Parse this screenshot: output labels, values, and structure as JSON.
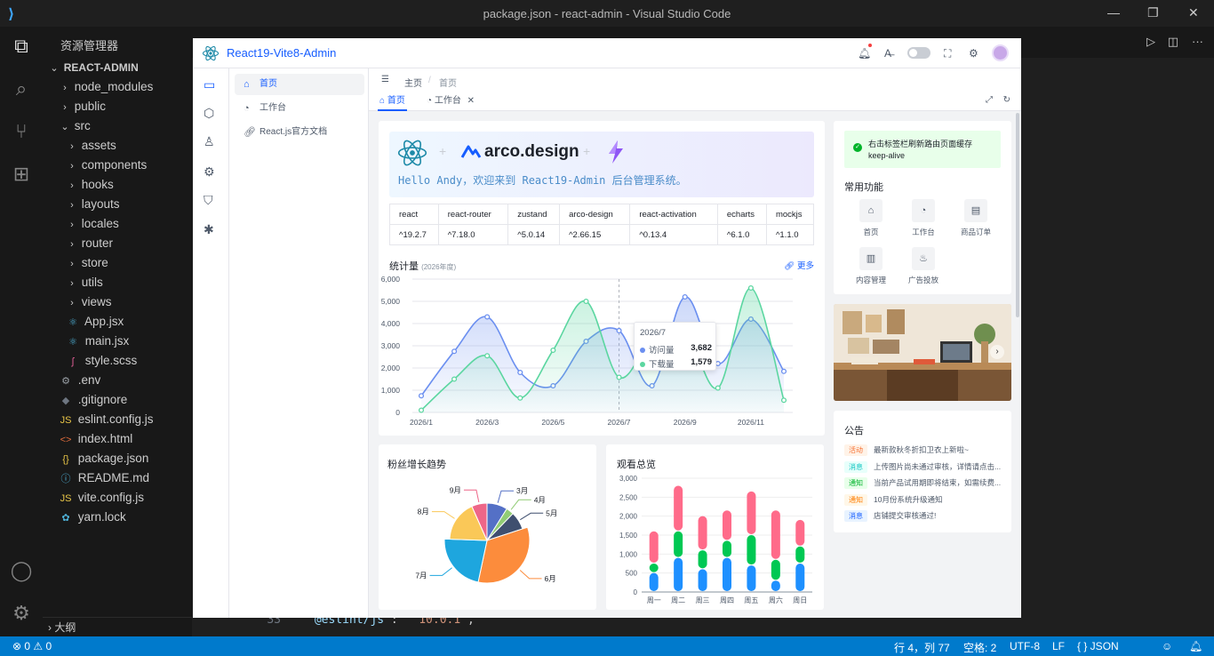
{
  "vscode": {
    "title": "package.json - react-admin - Visual Studio Code",
    "explorer_title": "资源管理器",
    "outline": "大纲",
    "tree": [
      {
        "label": "REACT-ADMIN",
        "kind": "root",
        "depth": 0
      },
      {
        "label": "node_modules",
        "kind": "folder",
        "depth": 1
      },
      {
        "label": "public",
        "kind": "folder",
        "depth": 1
      },
      {
        "label": "src",
        "kind": "open",
        "depth": 1
      },
      {
        "label": "assets",
        "kind": "folder",
        "depth": 2
      },
      {
        "label": "components",
        "kind": "folder",
        "depth": 2
      },
      {
        "label": "hooks",
        "kind": "folder",
        "depth": 2
      },
      {
        "label": "layouts",
        "kind": "folder",
        "depth": 2
      },
      {
        "label": "locales",
        "kind": "folder",
        "depth": 2
      },
      {
        "label": "router",
        "kind": "folder",
        "depth": 2
      },
      {
        "label": "store",
        "kind": "folder",
        "depth": 2
      },
      {
        "label": "utils",
        "kind": "folder",
        "depth": 2
      },
      {
        "label": "views",
        "kind": "folder",
        "depth": 2
      },
      {
        "label": "App.jsx",
        "kind": "react",
        "depth": 2
      },
      {
        "label": "main.jsx",
        "kind": "react",
        "depth": 2
      },
      {
        "label": "style.scss",
        "kind": "sass",
        "depth": 2
      },
      {
        "label": ".env",
        "kind": "gear",
        "depth": 1
      },
      {
        "label": ".gitignore",
        "kind": "git",
        "depth": 1
      },
      {
        "label": "eslint.config.js",
        "kind": "js",
        "depth": 1
      },
      {
        "label": "index.html",
        "kind": "html",
        "depth": 1
      },
      {
        "label": "package.json",
        "kind": "json",
        "depth": 1
      },
      {
        "label": "README.md",
        "kind": "info",
        "depth": 1
      },
      {
        "label": "vite.config.js",
        "kind": "js",
        "depth": 1
      },
      {
        "label": "yarn.lock",
        "kind": "yarn",
        "depth": 1
      }
    ],
    "code": {
      "line_no": "33",
      "key": "\"@eslint/js\"",
      "value": "\"^10.0.1\""
    },
    "status": {
      "errors": "⊗ 0 ⚠ 0",
      "position": "行 4，列 77",
      "spaces": "空格: 2",
      "encoding": "UTF-8",
      "eol": "LF",
      "lang": "{ } JSON"
    }
  },
  "app": {
    "name": "React19-Vite8-Admin",
    "menu": [
      "首页",
      "工作台",
      "React.js官方文档"
    ],
    "breadcrumb": [
      "主页",
      "首页"
    ],
    "tabs": [
      "首页",
      "工作台"
    ],
    "banner": {
      "brand": "arco.design",
      "greeting": "Hello Andy，欢迎来到 React19-Admin 后台管理系统。"
    },
    "versions": {
      "headers": [
        "react",
        "react-router",
        "zustand",
        "arco-design",
        "react-activation",
        "echarts",
        "mockjs"
      ],
      "values": [
        "^19.2.7",
        "^7.18.0",
        "^5.0.14",
        "^2.66.15",
        "^0.13.4",
        "^6.1.0",
        "^1.1.0"
      ]
    },
    "stats_title": "统计量",
    "stats_sub": "(2026年度)",
    "more": "更多",
    "tooltip": {
      "title": "2026/7",
      "rows": [
        {
          "label": "访问量",
          "value": "3,682"
        },
        {
          "label": "下载量",
          "value": "1,579"
        }
      ]
    },
    "alert": {
      "line1": "右击标签栏刷新路由页面缓存",
      "line2": "keep-alive"
    },
    "common_title": "常用功能",
    "functions": [
      "首页",
      "工作台",
      "商品订单",
      "内容管理",
      "广告投放"
    ],
    "notice_title": "公告",
    "notices": [
      {
        "tag": "活动",
        "text": "最新款秋冬折扣卫衣上新啦~",
        "color": "#f77234",
        "bg": "#fff3e8"
      },
      {
        "tag": "消息",
        "text": "上传图片尚未通过审核，详情请点击...",
        "color": "#0fc6c2",
        "bg": "#e8fffb"
      },
      {
        "tag": "通知",
        "text": "当前产品试用期即将结束，如需续费...",
        "color": "#00b42a",
        "bg": "#e8ffea"
      },
      {
        "tag": "通知",
        "text": "10月份系统升级通知",
        "color": "#ff7d00",
        "bg": "#fff7e8"
      },
      {
        "tag": "消息",
        "text": "店铺提交审核通过!",
        "color": "#165dff",
        "bg": "#e8f3ff"
      }
    ],
    "fans_title": "粉丝增长趋势",
    "views_title": "观看总览"
  },
  "chart_data": [
    {
      "type": "area",
      "title": "统计量",
      "x": [
        "2026/1",
        "2026/2",
        "2026/3",
        "2026/4",
        "2026/5",
        "2026/6",
        "2026/7",
        "2026/8",
        "2026/9",
        "2026/10",
        "2026/11",
        "2026/12"
      ],
      "xticks": [
        "2026/1",
        "2026/3",
        "2026/5",
        "2026/7",
        "2026/9",
        "2026/11"
      ],
      "ylim": [
        0,
        6000
      ],
      "yticks": [
        "0",
        "1,000",
        "2,000",
        "3,000",
        "4,000",
        "5,000",
        "6,000"
      ],
      "series": [
        {
          "name": "访问量",
          "color": "#6b8ff0",
          "values": [
            750,
            2750,
            4300,
            1800,
            1200,
            3200,
            3682,
            1200,
            5200,
            2200,
            4200,
            1850
          ]
        },
        {
          "name": "下载量",
          "color": "#5bd6a0",
          "values": [
            100,
            1500,
            2550,
            650,
            2800,
            5000,
            1579,
            3300,
            3700,
            1100,
            5600,
            550
          ]
        }
      ]
    },
    {
      "type": "pie",
      "title": "粉丝增长趋势",
      "categories": [
        "3月",
        "4月",
        "5月",
        "6月",
        "7月",
        "8月",
        "9月"
      ],
      "values": [
        8,
        3,
        7,
        30,
        20,
        16,
        6
      ],
      "colors": [
        "#5470c6",
        "#91cc75",
        "#3f4f6f",
        "#fc8c3c",
        "#1ea6de",
        "#fac858",
        "#ee6688"
      ]
    },
    {
      "type": "bar",
      "title": "观看总览",
      "categories": [
        "周一",
        "周二",
        "周三",
        "周四",
        "周五",
        "周六",
        "周日"
      ],
      "ylim": [
        0,
        3000
      ],
      "yticks": [
        "0",
        "500",
        "1,000",
        "1,500",
        "2,000",
        "2,500",
        "3,000"
      ],
      "series": [
        {
          "color": "#1e90ff",
          "values": [
            500,
            900,
            600,
            900,
            700,
            300,
            750
          ]
        },
        {
          "color": "#00c853",
          "values": [
            250,
            700,
            500,
            450,
            800,
            550,
            450
          ]
        },
        {
          "color": "#ff6b8a",
          "values": [
            850,
            1200,
            900,
            800,
            1150,
            1300,
            700
          ]
        }
      ]
    }
  ]
}
